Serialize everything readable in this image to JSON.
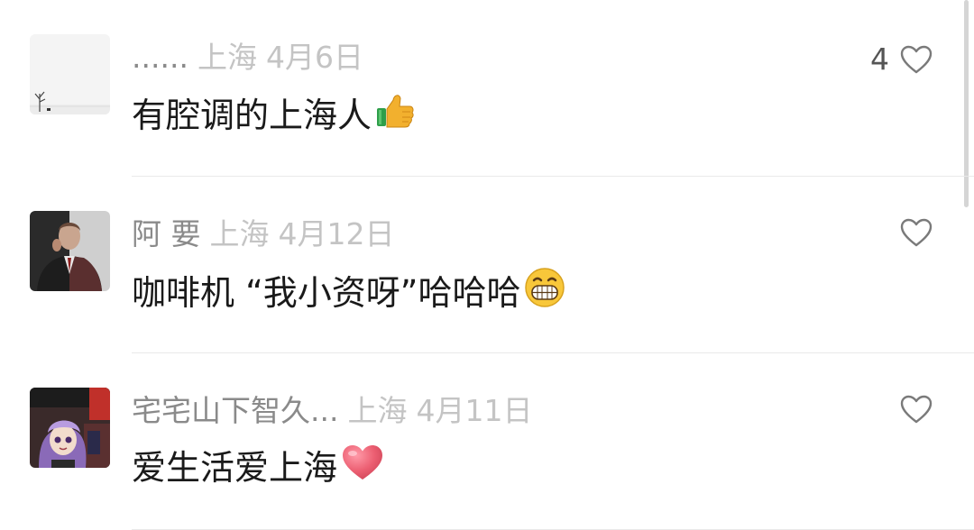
{
  "comments": [
    {
      "author": "......",
      "location": "上海",
      "date": "4月6日",
      "text": "有腔调的上海人",
      "emoji": "thumbs-up",
      "likes": "4"
    },
    {
      "author": "阿 要",
      "location": "上海",
      "date": "4月12日",
      "text": "咖啡机 “我小资呀”哈哈哈",
      "emoji": "grinning-face",
      "likes": ""
    },
    {
      "author": "宅宅山下智久...",
      "location": "上海",
      "date": "4月11日",
      "text": "爱生活爱上海",
      "emoji": "heart",
      "likes": ""
    }
  ],
  "colors": {
    "name": "#8a8a8a",
    "meta": "#c4c4c4",
    "text": "#1a1a1a",
    "divider": "#e9e9e9"
  }
}
